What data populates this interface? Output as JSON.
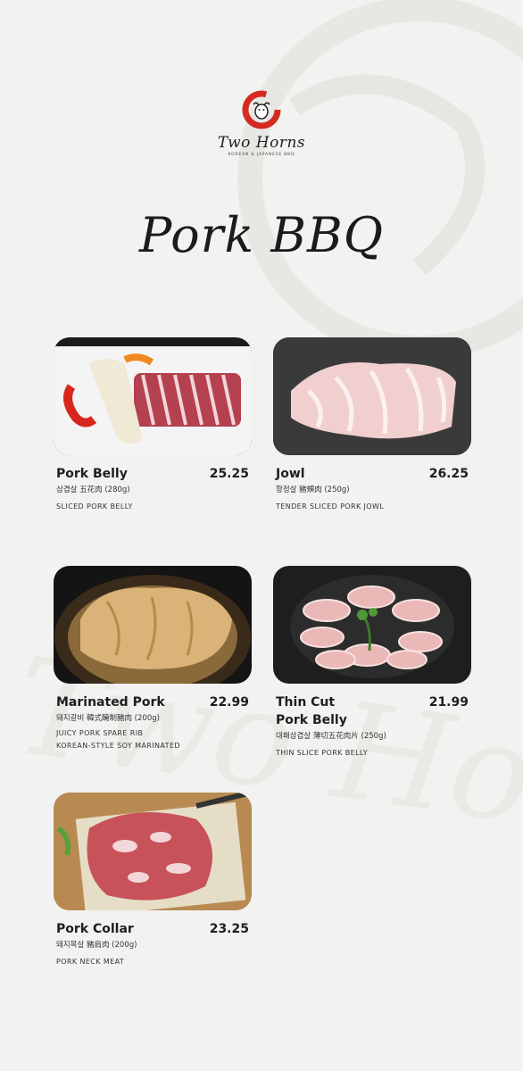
{
  "brand": {
    "name": "Two Horns",
    "tagline": "KOREAN & JAPANESE BBQ"
  },
  "page_title": "Pork BBQ",
  "items": [
    {
      "name": "Pork Belly",
      "price": "25.25",
      "subtitle": "삼겹살 五花肉 (280g)",
      "description": "SLICED PORK BELLY",
      "description2": ""
    },
    {
      "name": "Jowl",
      "price": "26.25",
      "subtitle": "항정살 豬頰肉 (250g)",
      "description": "TENDER SLICED PORK JOWL",
      "description2": ""
    },
    {
      "name": "Marinated Pork",
      "price": "22.99",
      "subtitle": "돼지갈비 韓式醃制豬肉 (200g)",
      "description": "JUICY PORK SPARE RIB",
      "description2": "KOREAN-STYLE SOY MARINATED"
    },
    {
      "name": "Thin Cut",
      "name2": "Pork Belly",
      "price": "21.99",
      "subtitle": "대패삼겹살 薄切五花肉片 (250g)",
      "description": "THIN SLICE PORK BELLY",
      "description2": ""
    },
    {
      "name": "Pork Collar",
      "price": "23.25",
      "subtitle": "돼지목살 豬肩肉 (200g)",
      "description": "PORK NECK MEAT",
      "description2": ""
    }
  ],
  "colors": {
    "background": "#f2f2f0",
    "brand_red": "#d42a22",
    "text": "#1e1e1e"
  }
}
